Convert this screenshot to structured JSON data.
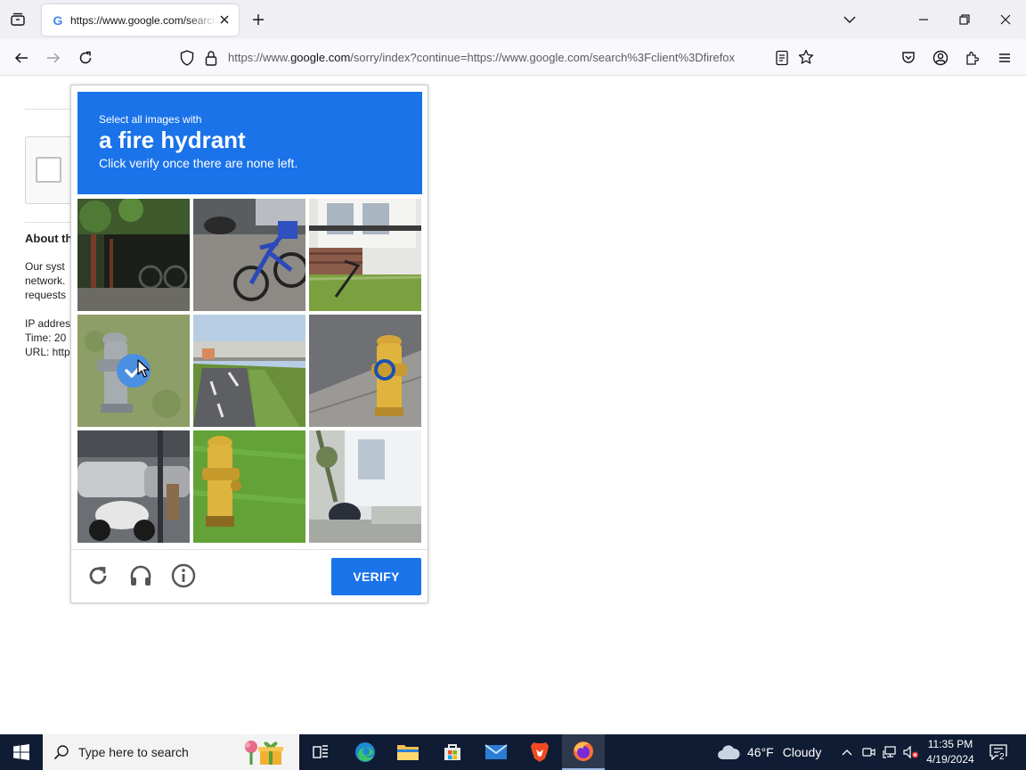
{
  "browser": {
    "tab_title": "https://www.google.com/search?client=firefox",
    "url_prefix": "https://www.",
    "url_host": "google.com",
    "url_rest": "/sorry/index?continue=https://www.google.com/search%3Fclient%3Dfirefox"
  },
  "background_page": {
    "about_heading": "About th",
    "paragraph_lines": [
      "Our syst",
      "network.",
      "requests"
    ],
    "info_lines": [
      "IP addres",
      "Time: 20",
      "URL: http"
    ]
  },
  "captcha": {
    "instruction_prefix": "Select all images with",
    "target_object": "a fire hydrant",
    "instruction_suffix": "Click verify once there are none left.",
    "verify_label": "VERIFY",
    "tiles": [
      {
        "scene": "bicycle parked under dark porch",
        "selected": false,
        "loading": false
      },
      {
        "scene": "blue bicycle on street",
        "selected": false,
        "loading": false
      },
      {
        "scene": "house steps and lawn",
        "selected": false,
        "loading": false
      },
      {
        "scene": "grey fire hydrant on grass",
        "selected": true,
        "loading": false
      },
      {
        "scene": "road under bridge",
        "selected": false,
        "loading": false
      },
      {
        "scene": "yellow fire hydrant on sidewalk",
        "selected": false,
        "loading": true
      },
      {
        "scene": "motorcycles and cars on street",
        "selected": false,
        "loading": false
      },
      {
        "scene": "yellow fire hydrant on grass",
        "selected": false,
        "loading": false
      },
      {
        "scene": "motorcycle by white building",
        "selected": false,
        "loading": false
      }
    ]
  },
  "taskbar": {
    "search_placeholder": "Type here to search",
    "weather_temp": "46°F",
    "weather_condition": "Cloudy",
    "time": "11:35 PM",
    "date": "4/19/2024",
    "notification_count": "2"
  },
  "colors": {
    "captcha_blue": "#1a73e8",
    "taskbar_bg": "#0f1c33",
    "tabbar_bg": "#f0f0f4"
  }
}
